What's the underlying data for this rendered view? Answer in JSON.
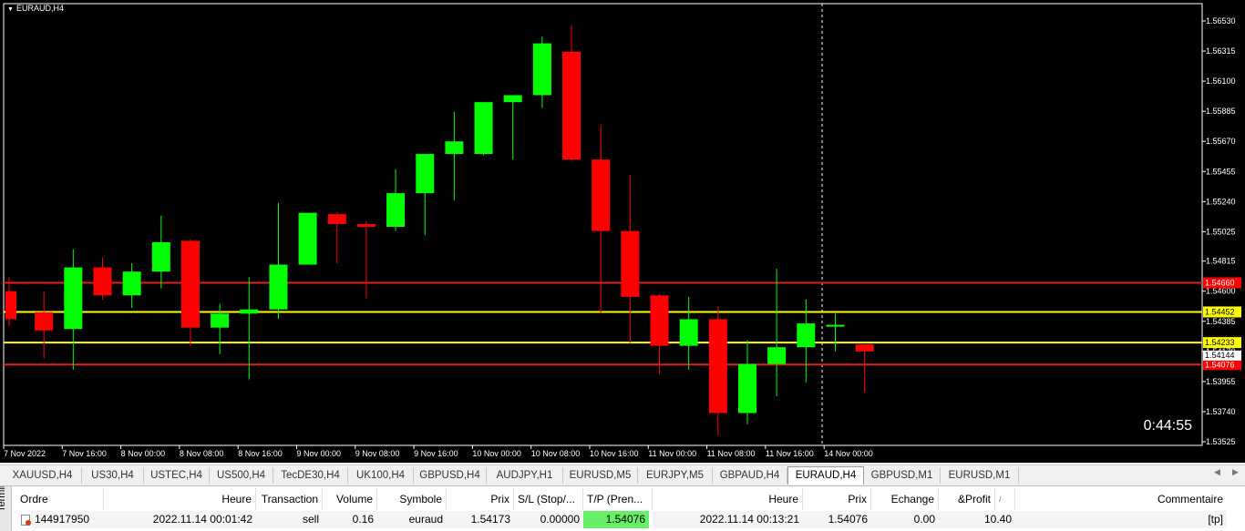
{
  "chart": {
    "title": "EURAUD,H4",
    "countdown": "0:44:55",
    "price_axis": [
      "1.56530",
      "1.56315",
      "1.56100",
      "1.55885",
      "1.55670",
      "1.55455",
      "1.55240",
      "1.55025",
      "1.54815",
      "1.54600",
      "1.54385",
      "1.54170",
      "1.53955",
      "1.53740",
      "1.53525"
    ],
    "time_axis": [
      "7 Nov 2022",
      "7 Nov 16:00",
      "8 Nov 00:00",
      "8 Nov 08:00",
      "8 Nov 16:00",
      "9 Nov 00:00",
      "9 Nov 08:00",
      "9 Nov 16:00",
      "10 Nov 00:00",
      "10 Nov 08:00",
      "10 Nov 16:00",
      "11 Nov 00:00",
      "11 Nov 08:00",
      "11 Nov 16:00",
      "14 Nov 00:00"
    ],
    "colors": {
      "bull": "#00ff00",
      "bear": "#ff0000",
      "background": "#000000",
      "tp_line": "#ffff00",
      "sl_line": "#e02020",
      "grid": "#ffffff"
    },
    "hlines": [
      {
        "price": 1.5466,
        "color": "#e02020",
        "label": "1.54660",
        "label_bg": "#ff0000",
        "label_fg": "#ffffff"
      },
      {
        "price": 1.54452,
        "color": "#ffff00",
        "label": "1.54452",
        "label_bg": "#ffff00",
        "label_fg": "#000000"
      },
      {
        "price": 1.54233,
        "color": "#ffff00",
        "label": "1.54233",
        "label_bg": "#ffff00",
        "label_fg": "#000000"
      },
      {
        "price": 1.54076,
        "color": "#e02020",
        "label": "1.54076",
        "label_bg": "#ff0000",
        "label_fg": "#ffffff"
      }
    ],
    "bid_label": {
      "price": 1.54144,
      "label": "1.54144"
    },
    "candles": [
      {
        "o": 1.546,
        "h": 1.547,
        "l": 1.5435,
        "c": 1.544
      },
      {
        "o": 1.5445,
        "h": 1.546,
        "l": 1.5412,
        "c": 1.5432
      },
      {
        "o": 1.5433,
        "h": 1.549,
        "l": 1.5404,
        "c": 1.5477
      },
      {
        "o": 1.5477,
        "h": 1.5484,
        "l": 1.5454,
        "c": 1.5457
      },
      {
        "o": 1.5457,
        "h": 1.548,
        "l": 1.5448,
        "c": 1.5474
      },
      {
        "o": 1.5474,
        "h": 1.5514,
        "l": 1.5462,
        "c": 1.5495
      },
      {
        "o": 1.5496,
        "h": 1.5497,
        "l": 1.5421,
        "c": 1.5434
      },
      {
        "o": 1.5434,
        "h": 1.5451,
        "l": 1.5415,
        "c": 1.5444
      },
      {
        "o": 1.5444,
        "h": 1.547,
        "l": 1.5397,
        "c": 1.5447
      },
      {
        "o": 1.5447,
        "h": 1.5523,
        "l": 1.544,
        "c": 1.5479
      },
      {
        "o": 1.5479,
        "h": 1.5516,
        "l": 1.5479,
        "c": 1.5516
      },
      {
        "o": 1.5515,
        "h": 1.5516,
        "l": 1.548,
        "c": 1.5508
      },
      {
        "o": 1.5508,
        "h": 1.551,
        "l": 1.5455,
        "c": 1.5506
      },
      {
        "o": 1.5506,
        "h": 1.5547,
        "l": 1.5503,
        "c": 1.553
      },
      {
        "o": 1.553,
        "h": 1.5557,
        "l": 1.55,
        "c": 1.5558
      },
      {
        "o": 1.5558,
        "h": 1.5588,
        "l": 1.5525,
        "c": 1.5567
      },
      {
        "o": 1.5558,
        "h": 1.5595,
        "l": 1.5557,
        "c": 1.5595
      },
      {
        "o": 1.5595,
        "h": 1.56,
        "l": 1.5554,
        "c": 1.56
      },
      {
        "o": 1.56,
        "h": 1.5642,
        "l": 1.5591,
        "c": 1.5637
      },
      {
        "o": 1.5631,
        "h": 1.565,
        "l": 1.5553,
        "c": 1.5554
      },
      {
        "o": 1.5554,
        "h": 1.5579,
        "l": 1.5444,
        "c": 1.5503
      },
      {
        "o": 1.5503,
        "h": 1.5543,
        "l": 1.5423,
        "c": 1.5456
      },
      {
        "o": 1.5457,
        "h": 1.5458,
        "l": 1.5401,
        "c": 1.5421
      },
      {
        "o": 1.5421,
        "h": 1.5456,
        "l": 1.5404,
        "c": 1.544
      },
      {
        "o": 1.544,
        "h": 1.5449,
        "l": 1.5357,
        "c": 1.5373
      },
      {
        "o": 1.5373,
        "h": 1.5425,
        "l": 1.5365,
        "c": 1.5408
      },
      {
        "o": 1.5408,
        "h": 1.5476,
        "l": 1.5385,
        "c": 1.542
      },
      {
        "o": 1.542,
        "h": 1.5454,
        "l": 1.5395,
        "c": 1.5437
      },
      {
        "o": 1.5436,
        "h": 1.5444,
        "l": 1.5417,
        "c": 1.5436
      },
      {
        "o": 1.5422,
        "h": 1.5422,
        "l": 1.5388,
        "c": 1.5417
      }
    ]
  },
  "tabs": [
    "XAUUSD,H4",
    "US30,H4",
    "USTEC,H4",
    "US500,H4",
    "TecDE30,H4",
    "UK100,H4",
    "GBPUSD,H4",
    "AUDJPY,H1",
    "EURUSD,M5",
    "EURJPY,M5",
    "GBPAUD,H4",
    "EURAUD,H4",
    "GBPUSD,M1",
    "EURUSD,M1"
  ],
  "active_tab": "EURAUD,H4",
  "terminal": {
    "side_label": "Terminal",
    "columns": {
      "ordre": "Ordre",
      "heure": "Heure",
      "transaction": "Transaction",
      "volume": "Volume",
      "symbole": "Symbole",
      "prix": "Prix",
      "sl": "S/L (Stop/...",
      "tp": "T/P (Pren...",
      "heure2": "Heure",
      "prix2": "Prix",
      "echange": "Echange",
      "profit": "&Profit",
      "commentaire": "Commentaire"
    },
    "row": {
      "ordre": "144917950",
      "heure": "2022.11.14 00:01:42",
      "transaction": "sell",
      "volume": "0.16",
      "symbole": "euraud",
      "prix": "1.54173",
      "sl": "0.00000",
      "tp": "1.54076",
      "heure2": "2022.11.14 00:13:21",
      "prix2": "1.54076",
      "echange": "0.00",
      "profit": "10.40",
      "commentaire": "[tp]"
    },
    "tp_highlight": "#66ee66"
  }
}
